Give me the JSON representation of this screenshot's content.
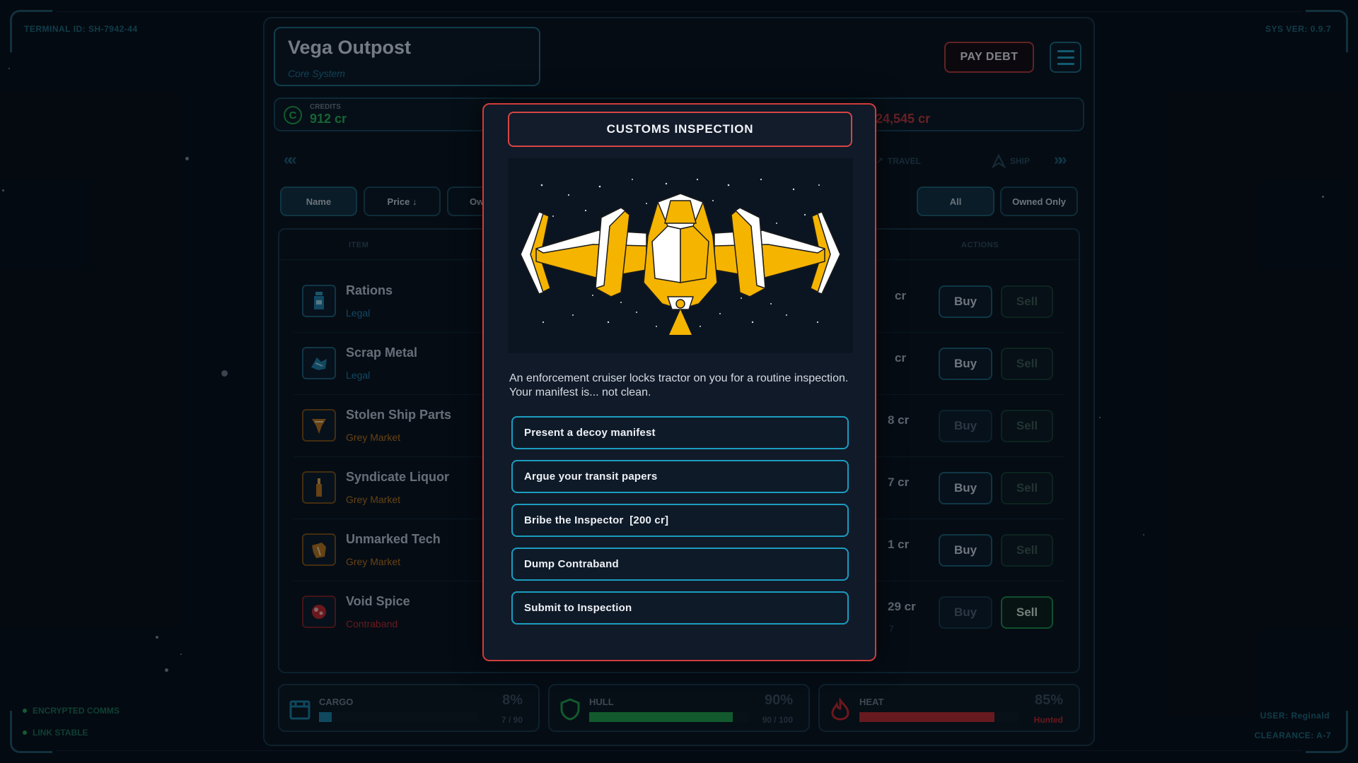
{
  "hud": {
    "terminal_id": "TERMINAL ID: SH-7942-44",
    "sys_ver": "SYS VER: 0.9.7",
    "status": [
      "ENCRYPTED COMMS",
      "LINK STABLE"
    ],
    "user": "USER: Reginald",
    "clearance": "CLEARANCE: A-7"
  },
  "station": {
    "name": "Vega Outpost",
    "system": "Core System"
  },
  "header": {
    "pay_debt_label": "PAY DEBT"
  },
  "credits": {
    "label": "CREDITS",
    "value": "912 cr",
    "debt_value": "24,545 cr"
  },
  "nav": {
    "left_arrows": "«",
    "right_arrows": "»",
    "tabs": [
      "TRAVEL",
      "SHIP"
    ]
  },
  "sort": {
    "name": "Name",
    "price": "Price ↓",
    "owned_fragment": "Ow"
  },
  "filter": {
    "all": "All",
    "owned": "Owned Only"
  },
  "table": {
    "headers": {
      "item": "ITEM",
      "actions": "ACTIONS"
    },
    "buy_label": "Buy",
    "sell_label": "Sell",
    "rows": [
      {
        "name": "Rations",
        "tag": "Legal",
        "price_fragment": "cr",
        "sub": ""
      },
      {
        "name": "Scrap Metal",
        "tag": "Legal",
        "price_fragment": "cr",
        "sub": ""
      },
      {
        "name": "Stolen Ship Parts",
        "tag": "Grey Market",
        "price_fragment": "8 cr",
        "sub": ""
      },
      {
        "name": "Syndicate Liquor",
        "tag": "Grey Market",
        "price_fragment": "7 cr",
        "sub": ""
      },
      {
        "name": "Unmarked Tech",
        "tag": "Grey Market",
        "price_fragment": "1 cr",
        "sub": ""
      },
      {
        "name": "Void Spice",
        "tag": "Contraband",
        "price_fragment": "29 cr",
        "sub": "7"
      }
    ]
  },
  "stats": {
    "cargo": {
      "label": "CARGO",
      "pct": "8%",
      "sub": "7 / 90",
      "level": 0.08
    },
    "hull": {
      "label": "HULL",
      "pct": "90%",
      "sub": "90 / 100",
      "level": 0.9
    },
    "heat": {
      "label": "HEAT",
      "pct": "85%",
      "sub": "Hunted",
      "level": 0.85
    }
  },
  "colors": {
    "accent": "#1b9cc0",
    "legal": "#1f7fa8",
    "grey_market": "#b8731d",
    "contraband": "#c1272d",
    "danger": "#d03c3c",
    "credits": "#27b158",
    "ship_yellow": "#f5b400"
  },
  "modal": {
    "title": "CUSTOMS INSPECTION",
    "description": "An enforcement cruiser locks tractor on you for a routine inspection. Your manifest is... not clean.",
    "choices": [
      "Present a decoy manifest",
      "Argue your transit papers",
      "Bribe the Inspector  [200 cr]",
      "Dump Contraband",
      "Submit to Inspection"
    ]
  }
}
